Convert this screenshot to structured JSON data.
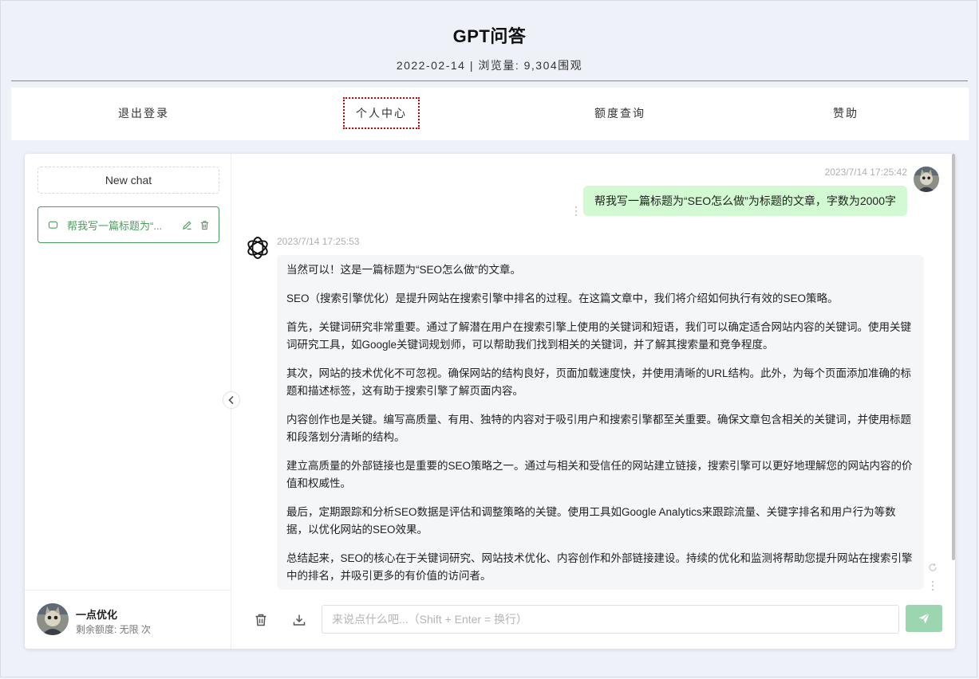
{
  "header": {
    "title": "GPT问答",
    "subtitle": "2022-02-14 | 浏览量: 9,304围观"
  },
  "nav": {
    "items": [
      {
        "label": "退出登录"
      },
      {
        "label": "个人中心"
      },
      {
        "label": "额度查询"
      },
      {
        "label": "赞助"
      }
    ]
  },
  "sidebar": {
    "new_chat_label": "New chat",
    "chat_items": [
      {
        "title": "帮我写一篇标题为“..."
      }
    ],
    "user": {
      "name": "一点优化",
      "quota": "剩余额度: 无限 次"
    }
  },
  "chat": {
    "user_message": {
      "time": "2023/7/14 17:25:42",
      "text": "帮我写一篇标题为“SEO怎么做”为标题的文章，字数为2000字"
    },
    "bot_message": {
      "time": "2023/7/14 17:25:53",
      "paragraphs": [
        "当然可以！这是一篇标题为“SEO怎么做”的文章。",
        "SEO（搜索引擎优化）是提升网站在搜索引擎中排名的过程。在这篇文章中，我们将介绍如何执行有效的SEO策略。",
        "首先，关键词研究非常重要。通过了解潜在用户在搜索引擎上使用的关键词和短语，我们可以确定适合网站内容的关键词。使用关键词研究工具，如Google关键词规划师，可以帮助我们找到相关的关键词，并了解其搜索量和竞争程度。",
        "其次，网站的技术优化不可忽视。确保网站的结构良好，页面加载速度快，并使用清晰的URL结构。此外，为每个页面添加准确的标题和描述标签，这有助于搜索引擎了解页面内容。",
        "内容创作也是关键。编写高质量、有用、独特的内容对于吸引用户和搜索引擎都至关重要。确保文章包含相关的关键词，并使用标题和段落划分清晰的结构。",
        "建立高质量的外部链接也是重要的SEO策略之一。通过与相关和受信任的网站建立链接，搜索引擎可以更好地理解您的网站内容的价值和权威性。",
        "最后，定期跟踪和分析SEO数据是评估和调整策略的关键。使用工具如Google Analytics来跟踪流量、关键字排名和用户行为等数据，以优化网站的SEO效果。",
        "总结起来，SEO的核心在于关键词研究、网站技术优化、内容创作和外部链接建设。持续的优化和监测将帮助您提升网站在搜索引擎中的排名，并吸引更多的有价值的访问者。"
      ]
    },
    "input": {
      "placeholder": "来说点什么吧...（Shift + Enter = 换行）",
      "value": ""
    }
  },
  "icons": {
    "chat": "chat-bubble-icon",
    "edit": "edit-icon",
    "delete": "trash-icon",
    "collapse": "chevron-left-icon",
    "bot": "openai-logo-icon",
    "clear": "trash-icon",
    "download": "download-icon",
    "send": "send-icon",
    "regenerate": "refresh-icon"
  },
  "colors": {
    "accent": "#4a9d5b",
    "user_bubble": "#d2f9d1",
    "bot_bubble": "#f4f6f8",
    "send_button": "#9bd6b0"
  }
}
